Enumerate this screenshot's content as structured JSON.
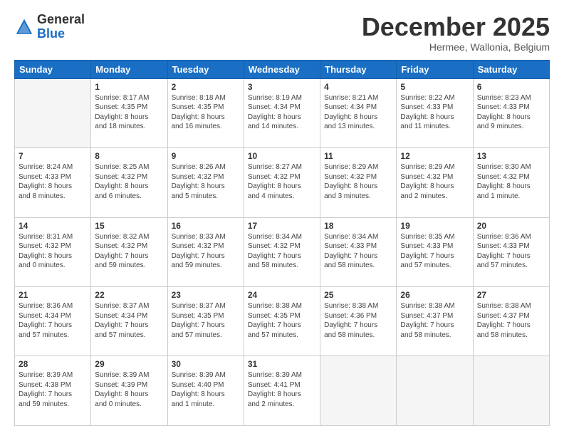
{
  "logo": {
    "general": "General",
    "blue": "Blue"
  },
  "header": {
    "month": "December 2025",
    "location": "Hermee, Wallonia, Belgium"
  },
  "weekdays": [
    "Sunday",
    "Monday",
    "Tuesday",
    "Wednesday",
    "Thursday",
    "Friday",
    "Saturday"
  ],
  "weeks": [
    [
      {
        "day": "",
        "info": ""
      },
      {
        "day": "1",
        "info": "Sunrise: 8:17 AM\nSunset: 4:35 PM\nDaylight: 8 hours\nand 18 minutes."
      },
      {
        "day": "2",
        "info": "Sunrise: 8:18 AM\nSunset: 4:35 PM\nDaylight: 8 hours\nand 16 minutes."
      },
      {
        "day": "3",
        "info": "Sunrise: 8:19 AM\nSunset: 4:34 PM\nDaylight: 8 hours\nand 14 minutes."
      },
      {
        "day": "4",
        "info": "Sunrise: 8:21 AM\nSunset: 4:34 PM\nDaylight: 8 hours\nand 13 minutes."
      },
      {
        "day": "5",
        "info": "Sunrise: 8:22 AM\nSunset: 4:33 PM\nDaylight: 8 hours\nand 11 minutes."
      },
      {
        "day": "6",
        "info": "Sunrise: 8:23 AM\nSunset: 4:33 PM\nDaylight: 8 hours\nand 9 minutes."
      }
    ],
    [
      {
        "day": "7",
        "info": "Sunrise: 8:24 AM\nSunset: 4:33 PM\nDaylight: 8 hours\nand 8 minutes."
      },
      {
        "day": "8",
        "info": "Sunrise: 8:25 AM\nSunset: 4:32 PM\nDaylight: 8 hours\nand 6 minutes."
      },
      {
        "day": "9",
        "info": "Sunrise: 8:26 AM\nSunset: 4:32 PM\nDaylight: 8 hours\nand 5 minutes."
      },
      {
        "day": "10",
        "info": "Sunrise: 8:27 AM\nSunset: 4:32 PM\nDaylight: 8 hours\nand 4 minutes."
      },
      {
        "day": "11",
        "info": "Sunrise: 8:29 AM\nSunset: 4:32 PM\nDaylight: 8 hours\nand 3 minutes."
      },
      {
        "day": "12",
        "info": "Sunrise: 8:29 AM\nSunset: 4:32 PM\nDaylight: 8 hours\nand 2 minutes."
      },
      {
        "day": "13",
        "info": "Sunrise: 8:30 AM\nSunset: 4:32 PM\nDaylight: 8 hours\nand 1 minute."
      }
    ],
    [
      {
        "day": "14",
        "info": "Sunrise: 8:31 AM\nSunset: 4:32 PM\nDaylight: 8 hours\nand 0 minutes."
      },
      {
        "day": "15",
        "info": "Sunrise: 8:32 AM\nSunset: 4:32 PM\nDaylight: 7 hours\nand 59 minutes."
      },
      {
        "day": "16",
        "info": "Sunrise: 8:33 AM\nSunset: 4:32 PM\nDaylight: 7 hours\nand 59 minutes."
      },
      {
        "day": "17",
        "info": "Sunrise: 8:34 AM\nSunset: 4:32 PM\nDaylight: 7 hours\nand 58 minutes."
      },
      {
        "day": "18",
        "info": "Sunrise: 8:34 AM\nSunset: 4:33 PM\nDaylight: 7 hours\nand 58 minutes."
      },
      {
        "day": "19",
        "info": "Sunrise: 8:35 AM\nSunset: 4:33 PM\nDaylight: 7 hours\nand 57 minutes."
      },
      {
        "day": "20",
        "info": "Sunrise: 8:36 AM\nSunset: 4:33 PM\nDaylight: 7 hours\nand 57 minutes."
      }
    ],
    [
      {
        "day": "21",
        "info": "Sunrise: 8:36 AM\nSunset: 4:34 PM\nDaylight: 7 hours\nand 57 minutes."
      },
      {
        "day": "22",
        "info": "Sunrise: 8:37 AM\nSunset: 4:34 PM\nDaylight: 7 hours\nand 57 minutes."
      },
      {
        "day": "23",
        "info": "Sunrise: 8:37 AM\nSunset: 4:35 PM\nDaylight: 7 hours\nand 57 minutes."
      },
      {
        "day": "24",
        "info": "Sunrise: 8:38 AM\nSunset: 4:35 PM\nDaylight: 7 hours\nand 57 minutes."
      },
      {
        "day": "25",
        "info": "Sunrise: 8:38 AM\nSunset: 4:36 PM\nDaylight: 7 hours\nand 58 minutes."
      },
      {
        "day": "26",
        "info": "Sunrise: 8:38 AM\nSunset: 4:37 PM\nDaylight: 7 hours\nand 58 minutes."
      },
      {
        "day": "27",
        "info": "Sunrise: 8:38 AM\nSunset: 4:37 PM\nDaylight: 7 hours\nand 58 minutes."
      }
    ],
    [
      {
        "day": "28",
        "info": "Sunrise: 8:39 AM\nSunset: 4:38 PM\nDaylight: 7 hours\nand 59 minutes."
      },
      {
        "day": "29",
        "info": "Sunrise: 8:39 AM\nSunset: 4:39 PM\nDaylight: 8 hours\nand 0 minutes."
      },
      {
        "day": "30",
        "info": "Sunrise: 8:39 AM\nSunset: 4:40 PM\nDaylight: 8 hours\nand 1 minute."
      },
      {
        "day": "31",
        "info": "Sunrise: 8:39 AM\nSunset: 4:41 PM\nDaylight: 8 hours\nand 2 minutes."
      },
      {
        "day": "",
        "info": ""
      },
      {
        "day": "",
        "info": ""
      },
      {
        "day": "",
        "info": ""
      }
    ]
  ]
}
